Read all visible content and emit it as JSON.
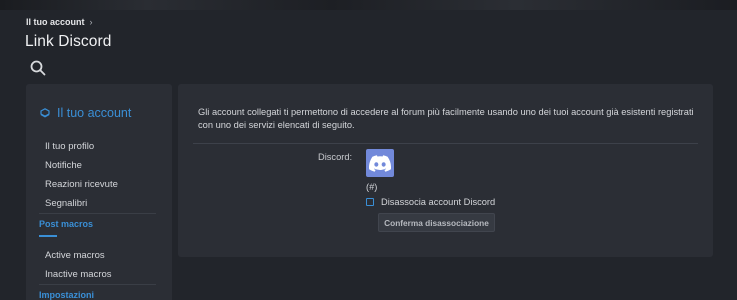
{
  "breadcrumb": {
    "items": [
      "Il tuo account"
    ]
  },
  "page": {
    "title": "Link Discord"
  },
  "sidebar": {
    "header": "Il tuo account",
    "items": [
      "Il tuo profilo",
      "Notifiche",
      "Reazioni ricevute",
      "Segnalibri"
    ],
    "section1": {
      "title": "Post macros",
      "items": [
        "Active macros",
        "Inactive macros"
      ]
    },
    "section2": {
      "title": "Impostazioni"
    }
  },
  "main": {
    "intro": "Gli account collegati ti permettono di accedere al forum più facilmente usando uno dei tuoi account già esistenti registrati con uno dei servizi elencati di seguito.",
    "field_label": "Discord:",
    "account_name": "(#)",
    "disassociate_label": "Disassocia account Discord",
    "confirm_label": "Conferma disassociazione"
  },
  "icons": {
    "search": "search-icon",
    "account": "account-icon",
    "discord": "discord-logo-icon"
  },
  "colors": {
    "accent": "#3a8fd6",
    "discord": "#7289da",
    "background": "#22252b",
    "panel": "#2b2e35"
  }
}
